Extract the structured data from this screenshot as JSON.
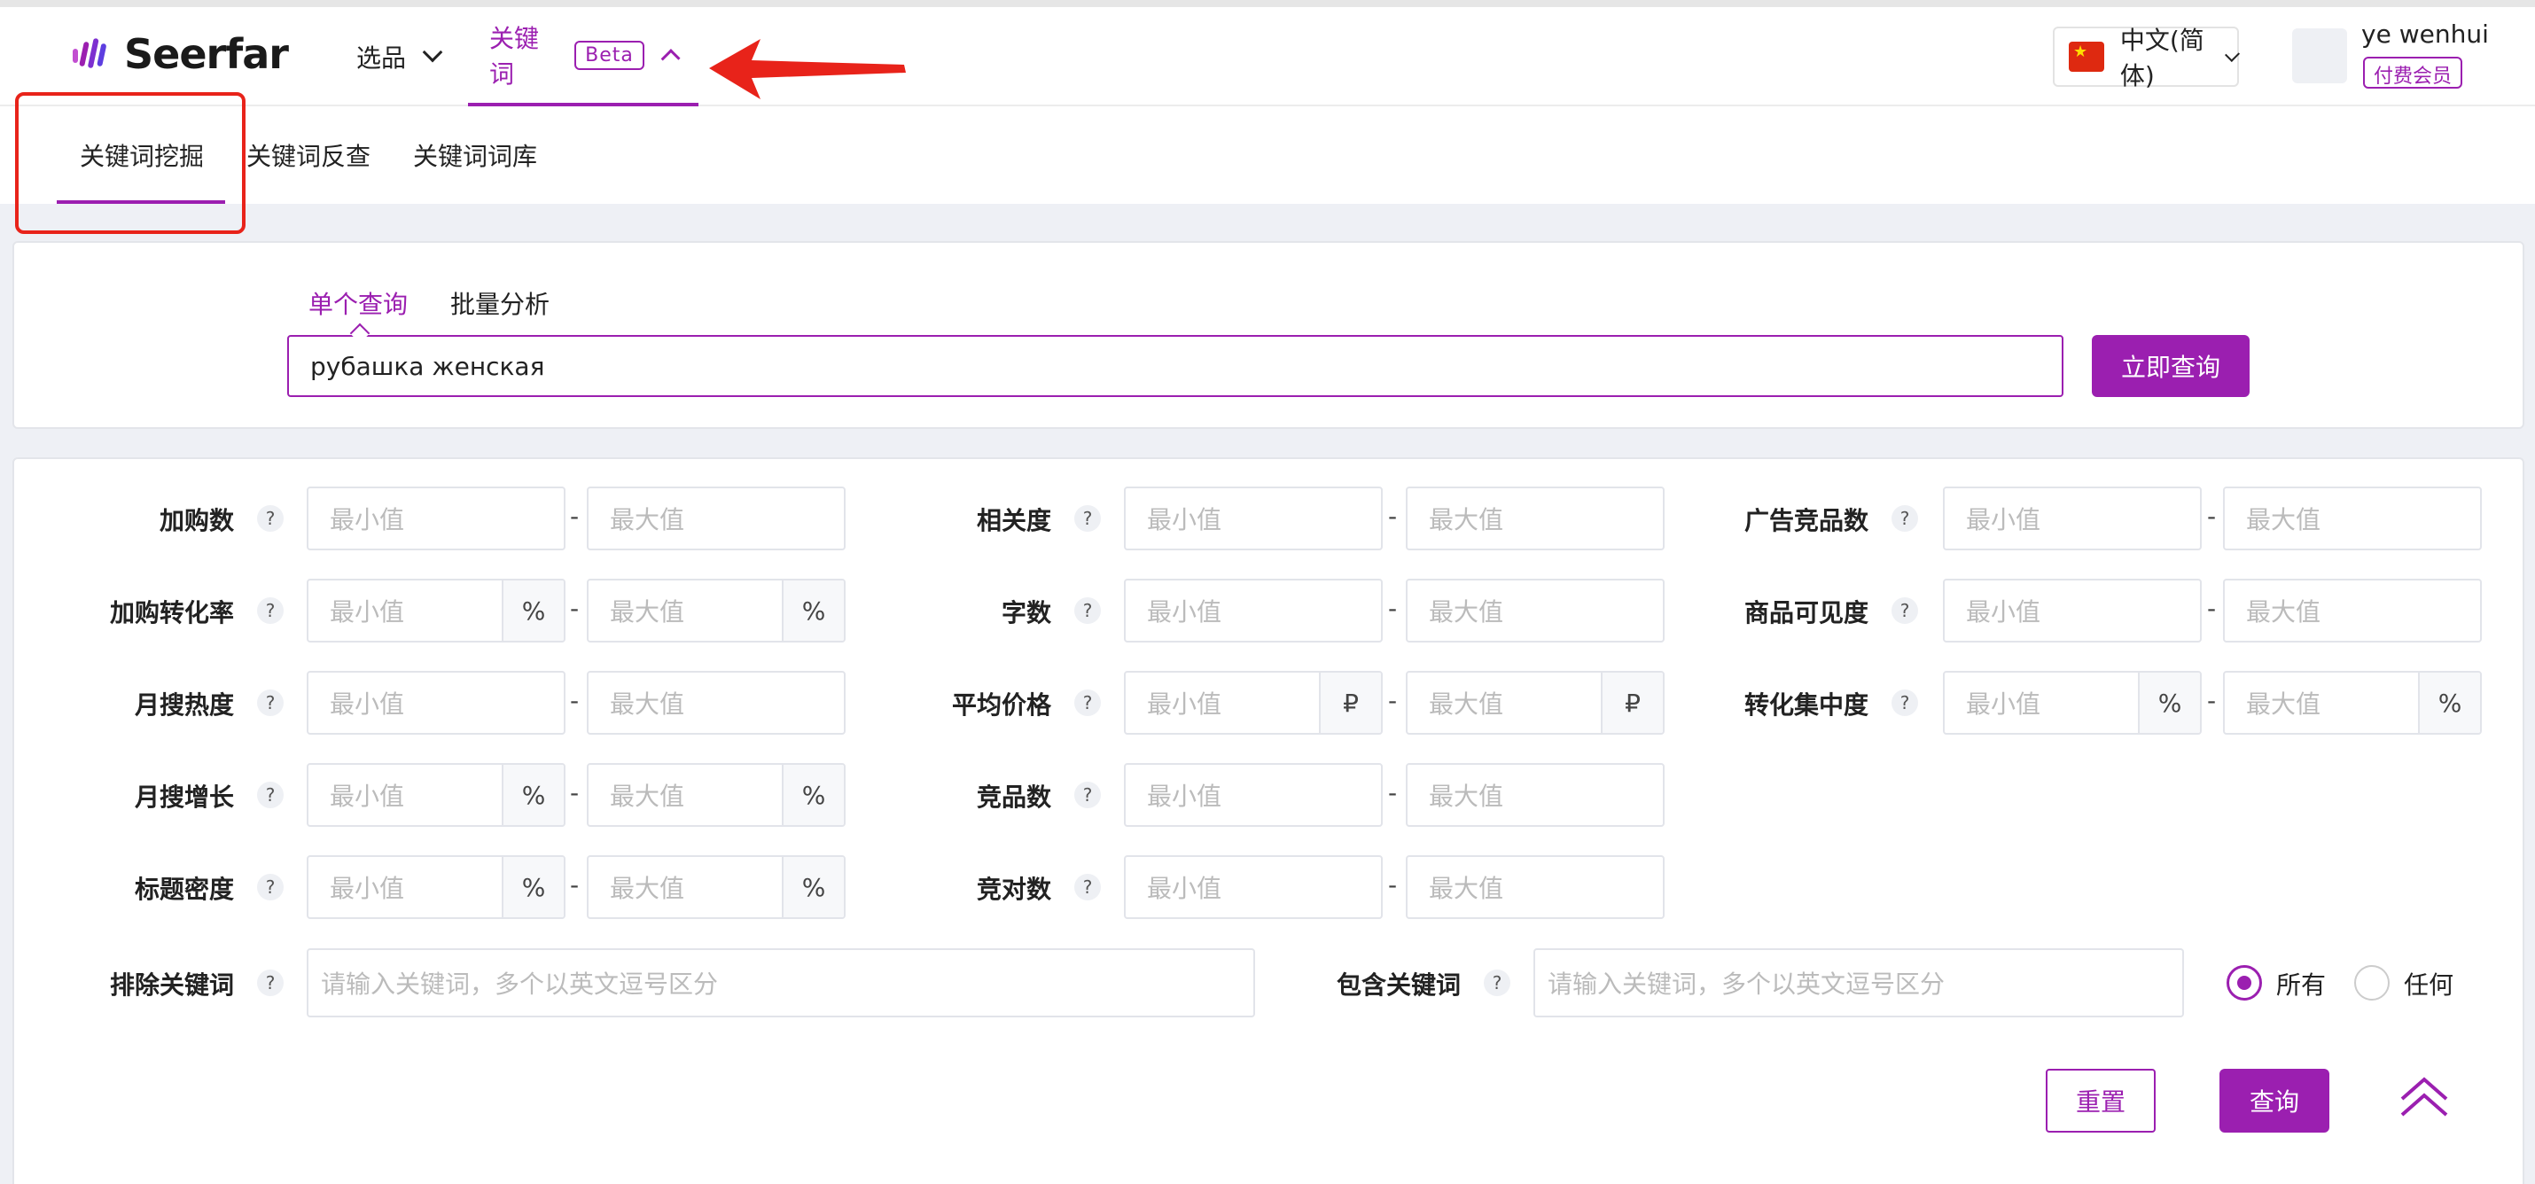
{
  "brand": {
    "name": "Seerfar",
    "accent": "#9b1fb0"
  },
  "nav": {
    "items": [
      {
        "label": "选品"
      },
      {
        "label": "关键词",
        "badge": "Beta"
      }
    ]
  },
  "lang": {
    "label": "中文(简体)"
  },
  "user": {
    "name": "ye wenhui",
    "badge": "付费会员"
  },
  "subtabs": [
    "关键词挖掘",
    "关键词反查",
    "关键词词库"
  ],
  "query": {
    "tabs": [
      "单个查询",
      "批量分析"
    ],
    "value": "рубашка женская",
    "button": "立即查询"
  },
  "filters": {
    "min_ph": "最小值",
    "max_ph": "最大值",
    "hint": "?",
    "dash": "-",
    "col1": [
      {
        "label": "加购数",
        "suffix": ""
      },
      {
        "label": "加购转化率",
        "suffix": "%"
      },
      {
        "label": "月搜热度",
        "suffix": ""
      },
      {
        "label": "月搜增长",
        "suffix": "%"
      },
      {
        "label": "标题密度",
        "suffix": "%"
      }
    ],
    "col2": [
      {
        "label": "相关度",
        "suffix": ""
      },
      {
        "label": "字数",
        "suffix": ""
      },
      {
        "label": "平均价格",
        "suffix": "₽"
      },
      {
        "label": "竞品数",
        "suffix": ""
      },
      {
        "label": "竞对数",
        "suffix": ""
      }
    ],
    "col3": [
      {
        "label": "广告竞品数",
        "suffix": ""
      },
      {
        "label": "商品可见度",
        "suffix": ""
      },
      {
        "label": "转化集中度",
        "suffix": "%"
      }
    ],
    "exclude": {
      "label": "排除关键词",
      "placeholder": "请输入关键词，多个以英文逗号区分"
    },
    "include": {
      "label": "包含关键词",
      "placeholder": "请输入关键词，多个以英文逗号区分"
    },
    "match": {
      "all": "所有",
      "any": "任何",
      "selected": "所有"
    }
  },
  "actions": {
    "reset": "重置",
    "query": "查询"
  }
}
